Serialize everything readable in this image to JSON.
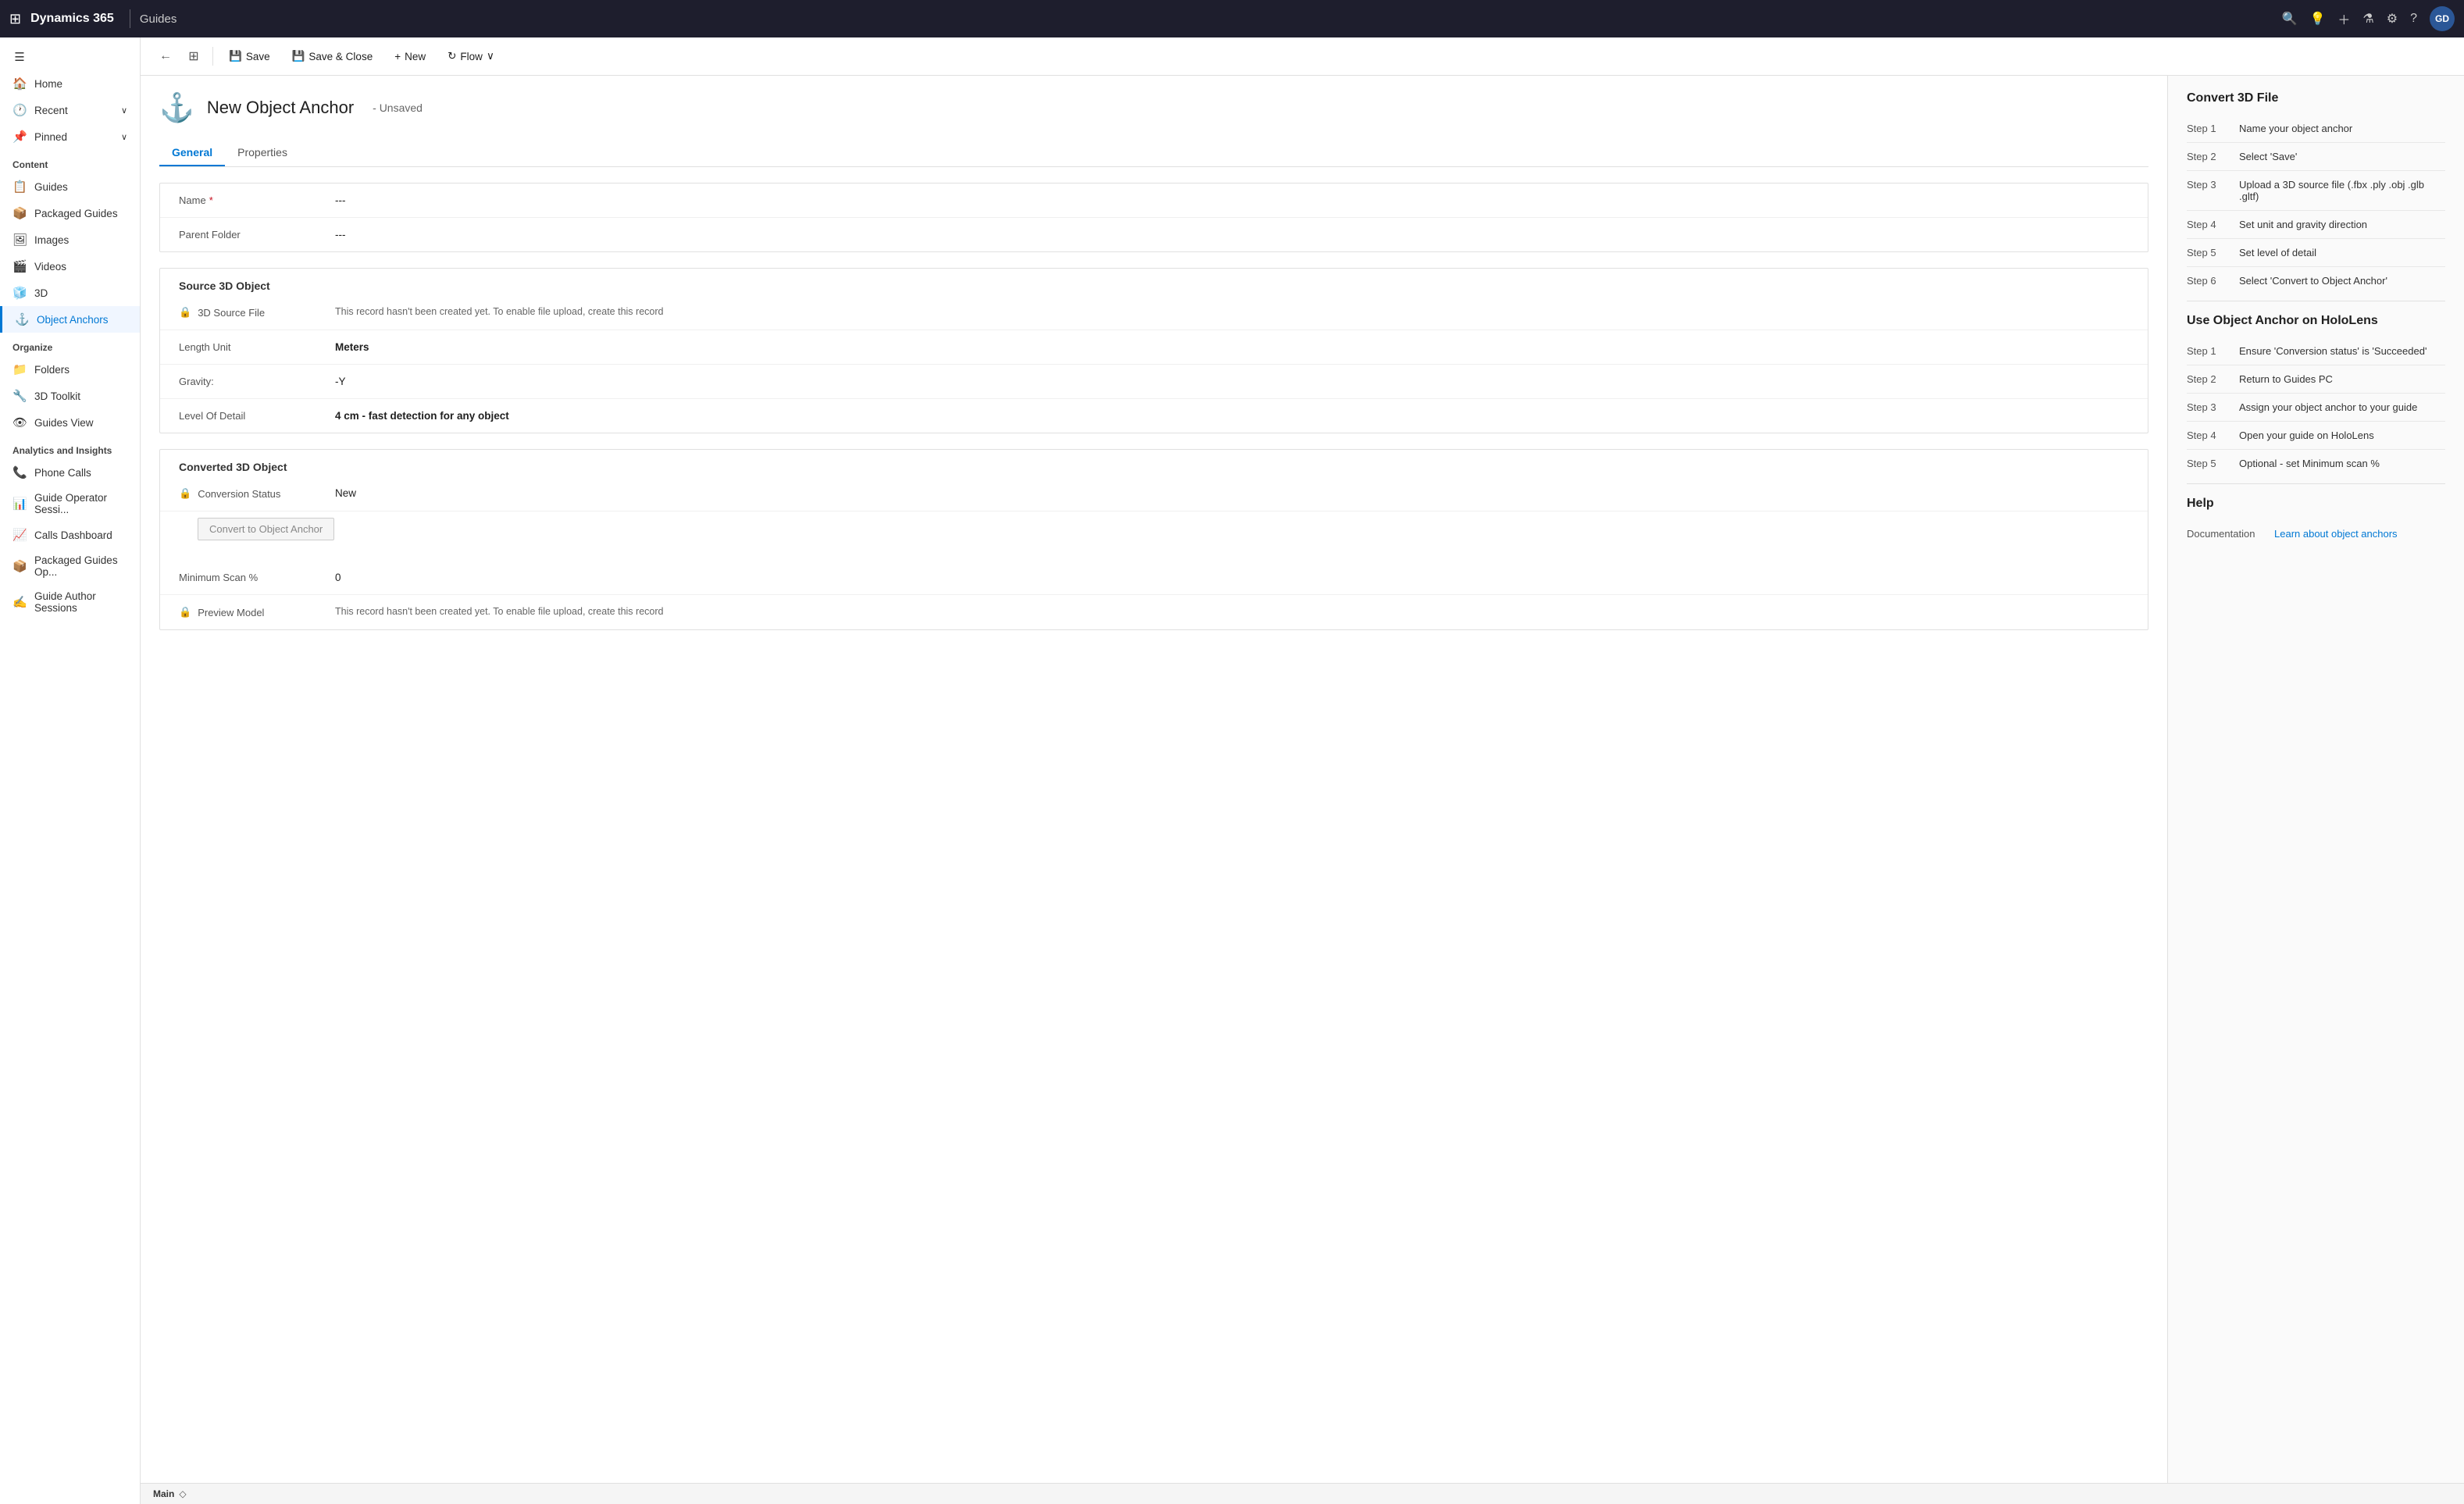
{
  "app": {
    "waffle_icon": "⊞",
    "title": "Dynamics 365",
    "divider": "|",
    "app_name": "Guides"
  },
  "topnav": {
    "search_icon": "🔍",
    "lightbulb_icon": "💡",
    "plus_icon": "+",
    "filter_icon": "⚗",
    "settings_icon": "⚙",
    "help_icon": "?",
    "avatar_label": "GD"
  },
  "sidebar": {
    "collapse_icon": "☰",
    "home_label": "Home",
    "recent_label": "Recent",
    "pinned_label": "Pinned",
    "content_section": "Content",
    "guides_label": "Guides",
    "packaged_guides_label": "Packaged Guides",
    "images_label": "Images",
    "videos_label": "Videos",
    "3d_label": "3D",
    "object_anchors_label": "Object Anchors",
    "organize_section": "Organize",
    "folders_label": "Folders",
    "3d_toolkit_label": "3D Toolkit",
    "guides_view_label": "Guides View",
    "analytics_section": "Analytics and Insights",
    "phone_calls_label": "Phone Calls",
    "guide_operator_label": "Guide Operator Sessi...",
    "calls_dashboard_label": "Calls Dashboard",
    "packaged_guides_op_label": "Packaged Guides Op...",
    "guide_author_label": "Guide Author Sessions"
  },
  "commandbar": {
    "back_icon": "←",
    "table_icon": "⊞",
    "save_label": "Save",
    "save_close_label": "Save & Close",
    "new_label": "New",
    "flow_label": "Flow",
    "chevron_down": "∨",
    "save_icon": "💾",
    "save_close_icon": "💾",
    "new_icon": "+",
    "flow_icon": "⟳"
  },
  "page": {
    "anchor_icon": "⚓",
    "title": "New Object Anchor",
    "status": "- Unsaved",
    "tab_general": "General",
    "tab_properties": "Properties"
  },
  "form": {
    "name_label": "Name",
    "name_required": "*",
    "name_value": "---",
    "parent_folder_label": "Parent Folder",
    "parent_folder_value": "---",
    "source_3d_section": "Source 3D Object",
    "source_3d_file_label": "3D Source File",
    "source_3d_file_value": "This record hasn't been created yet. To enable file upload, create this record",
    "length_unit_label": "Length Unit",
    "length_unit_value": "Meters",
    "gravity_label": "Gravity:",
    "gravity_value": "-Y",
    "level_of_detail_label": "Level Of Detail",
    "level_of_detail_value": "4 cm - fast detection for any object",
    "converted_3d_section": "Converted 3D Object",
    "conversion_status_label": "Conversion Status",
    "conversion_status_value": "New",
    "convert_button_label": "Convert to Object Anchor",
    "minimum_scan_label": "Minimum Scan %",
    "minimum_scan_value": "0",
    "preview_model_label": "Preview Model",
    "preview_model_value": "This record hasn't been created yet. To enable file upload, create this record"
  },
  "right_panel": {
    "convert_3d_title": "Convert 3D File",
    "convert_steps": [
      {
        "label": "Step 1",
        "text": "Name your object anchor"
      },
      {
        "label": "Step 2",
        "text": "Select 'Save'"
      },
      {
        "label": "Step 3",
        "text": "Upload a 3D source file (.fbx .ply .obj .glb .gltf)"
      },
      {
        "label": "Step 4",
        "text": "Set unit and gravity direction"
      },
      {
        "label": "Step 5",
        "text": "Set level of detail"
      },
      {
        "label": "Step 6",
        "text": "Select 'Convert to Object Anchor'"
      }
    ],
    "hololens_title": "Use Object Anchor on HoloLens",
    "hololens_steps": [
      {
        "label": "Step 1",
        "text": "Ensure 'Conversion status' is 'Succeeded'"
      },
      {
        "label": "Step 2",
        "text": "Return to Guides PC"
      },
      {
        "label": "Step 3",
        "text": "Assign your object anchor to your guide"
      },
      {
        "label": "Step 4",
        "text": "Open your guide on HoloLens"
      },
      {
        "label": "Step 5",
        "text": "Optional - set Minimum scan %"
      }
    ],
    "help_title": "Help",
    "help_doc_label": "Documentation",
    "help_link_text": "Learn about object anchors",
    "help_link_url": "#"
  },
  "bottombar": {
    "env_label": "Main",
    "env_icon": "◇"
  }
}
